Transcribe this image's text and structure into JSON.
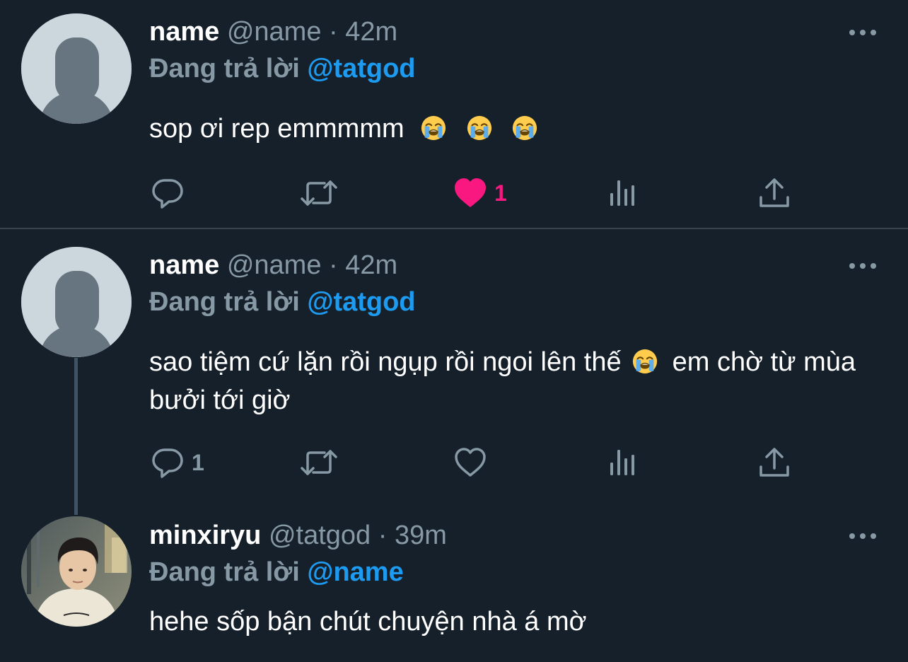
{
  "tweets": [
    {
      "display_name": "name",
      "handle": "@name",
      "separator": "·",
      "time": "42m",
      "reply_prefix": "Đang trả lời",
      "reply_to": "@tatgod",
      "text": "sop ơi rep emmmmm",
      "avatar": "default-avatar",
      "actions": {
        "reply_count": "",
        "like_count": "1",
        "liked": true
      }
    },
    {
      "display_name": "name",
      "handle": "@name",
      "separator": "·",
      "time": "42m",
      "reply_prefix": "Đang trả lời",
      "reply_to": "@tatgod",
      "text_part1": "sao tiệm cứ lặn rồi ngụp rồi ngoi lên thế",
      "text_part2": "em chờ từ mùa bưởi tới giờ",
      "avatar": "default-avatar",
      "actions": {
        "reply_count": "1",
        "like_count": "",
        "liked": false
      }
    },
    {
      "display_name": "minxiryu",
      "handle": "@tatgod",
      "separator": "·",
      "time": "39m",
      "reply_prefix": "Đang trả lời",
      "reply_to": "@name",
      "text": "hehe sốp bận chút chuyện nhà á mờ",
      "avatar": "photo-avatar"
    }
  ],
  "icons": {
    "emoji": "loudly-crying-face-emoji",
    "reply": "reply-icon",
    "retweet": "retweet-icon",
    "like": "heart-icon",
    "views": "views-icon",
    "share": "share-icon",
    "more": "more-icon"
  },
  "colors": {
    "background": "#15202b",
    "accent": "#1d9bf0",
    "like": "#f91880",
    "secondary_text": "#8899a6"
  }
}
